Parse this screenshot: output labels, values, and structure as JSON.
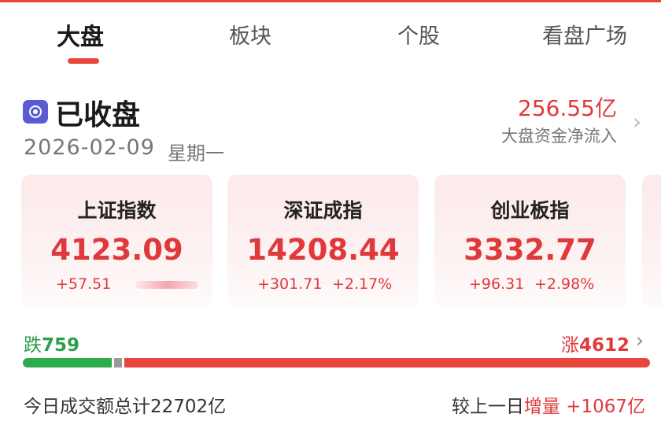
{
  "tabs": [
    {
      "label": "大盘",
      "active": true
    },
    {
      "label": "板块",
      "active": false
    },
    {
      "label": "个股",
      "active": false
    },
    {
      "label": "看盘广场",
      "active": false
    }
  ],
  "status": {
    "title": "已收盘",
    "date": "2026-02-09",
    "weekday": "星期一",
    "icon": "market-status-icon"
  },
  "netflow": {
    "value": "256.55亿",
    "label": "大盘资金净流入"
  },
  "indices": [
    {
      "name": "上证指数",
      "value": "4123.09",
      "change": "+57.51",
      "percent": ""
    },
    {
      "name": "深证成指",
      "value": "14208.44",
      "change": "+301.71",
      "percent": "+2.17%"
    },
    {
      "name": "创业板指",
      "value": "3332.77",
      "change": "+96.31",
      "percent": "+2.98%"
    }
  ],
  "breadth": {
    "fall_label": "跌",
    "fall_count": "759",
    "rise_label": "涨",
    "rise_count": "4612"
  },
  "turnover": {
    "text": "今日成交额总计22702亿",
    "compare_prefix": "较上一日",
    "compare_type": "增量",
    "compare_value": "+1067亿"
  },
  "colors": {
    "accent": "#e8453c",
    "up": "#e0393b",
    "down": "#2eaa4f",
    "status_icon": "#5a5cd6"
  }
}
